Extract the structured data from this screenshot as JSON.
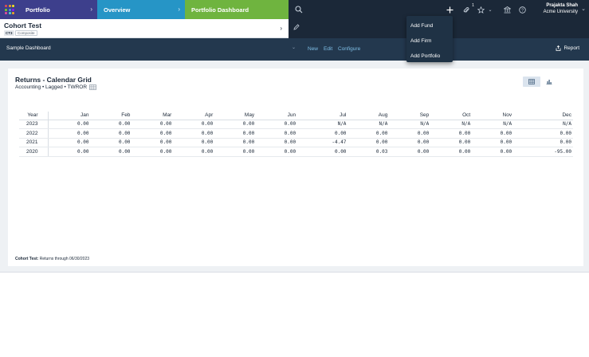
{
  "header": {
    "breadcrumbs": [
      {
        "label": "Portfolio"
      },
      {
        "label": "Overview"
      },
      {
        "label": "Portfolio Dashboard"
      }
    ],
    "notification_count": "1",
    "user": {
      "name": "Prajakta Shah",
      "org": "Acme University"
    }
  },
  "entity": {
    "name": "Cohort Test",
    "code": "CT3",
    "type": "Composite"
  },
  "dashboard": {
    "name": "Sample Dashboard",
    "actions": [
      "New",
      "Edit",
      "Configure"
    ],
    "report_label": "Report"
  },
  "add_menu": {
    "items": [
      "Add Fund",
      "Add Firm",
      "Add Portfolio"
    ]
  },
  "widget": {
    "title": "Returns - Calendar Grid",
    "subtitle": "Accounting • Lagged • TWROR",
    "columns": [
      "Year",
      "Jan",
      "Feb",
      "Mar",
      "Apr",
      "May",
      "Jun",
      "Jul",
      "Aug",
      "Sep",
      "Oct",
      "Nov",
      "Dec"
    ],
    "rows": [
      {
        "year": "2023",
        "values": [
          "0.00",
          "0.00",
          "0.00",
          "0.00",
          "0.00",
          "0.00",
          "N/A",
          "N/A",
          "N/A",
          "N/A",
          "N/A",
          "N/A"
        ]
      },
      {
        "year": "2022",
        "values": [
          "0.00",
          "0.00",
          "0.00",
          "0.00",
          "0.00",
          "0.00",
          "0.00",
          "0.00",
          "0.00",
          "0.00",
          "0.00",
          "0.00"
        ]
      },
      {
        "year": "2021",
        "values": [
          "0.00",
          "0.00",
          "0.00",
          "0.00",
          "0.00",
          "0.00",
          "-4.47",
          "0.00",
          "0.00",
          "0.00",
          "0.00",
          "0.00"
        ]
      },
      {
        "year": "2020",
        "values": [
          "0.00",
          "0.00",
          "0.00",
          "0.00",
          "0.00",
          "0.00",
          "0.00",
          "0.03",
          "0.00",
          "0.00",
          "0.00",
          "-95.00"
        ]
      }
    ],
    "footnote_label": "Cohort Test:",
    "footnote_text": "Returns through 06/30/2023"
  },
  "colors": {
    "portfolio_crumb": "#3d3f8c",
    "overview_crumb": "#2695c6",
    "dashboard_crumb": "#6fb43f",
    "topbar": "#1b2838",
    "negative": "#e04848",
    "na": "#b8c0c9"
  },
  "icons": {
    "app": "app-grid-icon",
    "search": "search-icon",
    "add": "plus-icon",
    "attach": "paperclip-icon",
    "favorite": "star-icon",
    "bank": "bank-icon",
    "help": "help-icon",
    "edit": "pencil-icon",
    "report": "share-icon",
    "table_view": "table-icon",
    "chart_view": "bar-chart-icon"
  }
}
